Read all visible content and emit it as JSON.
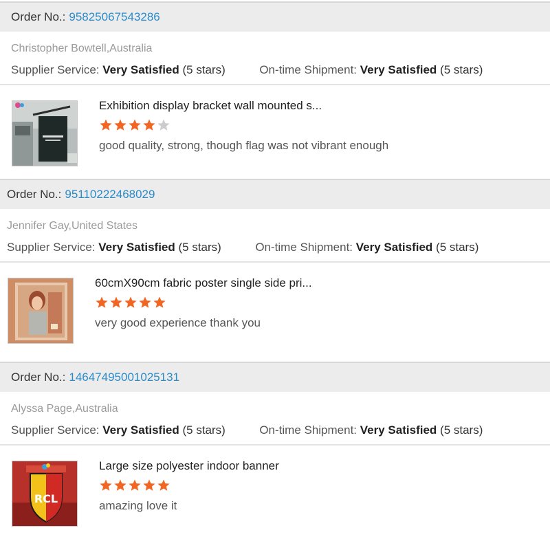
{
  "colors": {
    "link": "#2a8bc9",
    "star_on": "#f26522",
    "star_off": "#cccccc",
    "order_bar": "#ececec"
  },
  "labels": {
    "order_no": "Order No.:",
    "supplier_service": "Supplier Service:",
    "ontime_shipment": "On-time Shipment:"
  },
  "reviews": [
    {
      "order_number": "95825067543286",
      "buyer": "Christopher Bowtell,Australia",
      "supplier_rating": "Very Satisfied",
      "supplier_stars": "(5 stars)",
      "shipment_rating": "Very Satisfied",
      "shipment_stars": "(5 stars)",
      "product_title": "Exhibition display bracket wall mounted s...",
      "stars": 4,
      "comment": "good quality, strong, though flag was not vibrant enough",
      "thumb_icon": "wall-banner-photo"
    },
    {
      "order_number": "95110222468029",
      "buyer": "Jennifer Gay,United States",
      "supplier_rating": "Very Satisfied",
      "supplier_stars": "(5 stars)",
      "shipment_rating": "Very Satisfied",
      "shipment_stars": "(5 stars)",
      "product_title": "60cmX90cm fabric poster single side pri...",
      "stars": 5,
      "comment": "very good experience thank you",
      "thumb_icon": "fabric-poster-photo"
    },
    {
      "order_number": "14647495001025131",
      "buyer": "Alyssa Page,Australia",
      "supplier_rating": "Very Satisfied",
      "supplier_stars": "(5 stars)",
      "shipment_rating": "Very Satisfied",
      "shipment_stars": "(5 stars)",
      "product_title": "Large size polyester indoor banner",
      "stars": 5,
      "comment": "amazing love it",
      "thumb_icon": "rcl-banner-photo",
      "thumb_text": "RCL"
    }
  ]
}
